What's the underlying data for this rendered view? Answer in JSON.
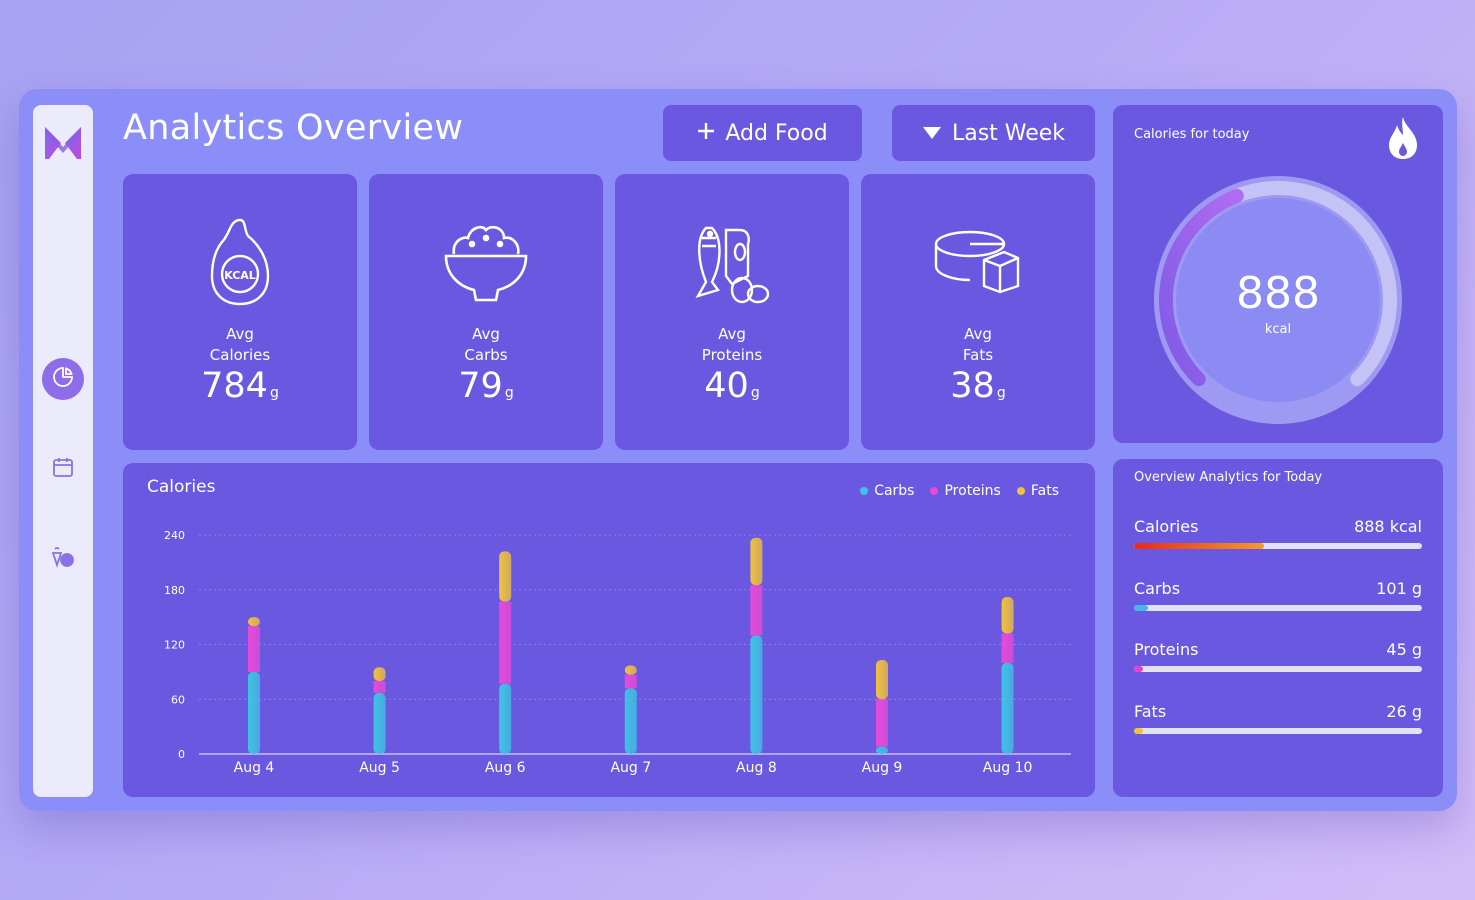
{
  "title": "Analytics Overview",
  "buttons": {
    "add_food": "Add Food",
    "period": "Last Week"
  },
  "sidebar": {
    "items": [
      {
        "icon": "pie-chart-icon"
      },
      {
        "icon": "calendar-icon"
      },
      {
        "icon": "food-icon"
      }
    ]
  },
  "stats": [
    {
      "label_1": "Avg",
      "label_2": "Calories",
      "value": "784",
      "unit": "g",
      "icon": "kcal-icon",
      "icon_text": "KCAL"
    },
    {
      "label_1": "Avg",
      "label_2": "Carbs",
      "value": "79",
      "unit": "g",
      "icon": "rice-bowl-icon"
    },
    {
      "label_1": "Avg",
      "label_2": "Proteins",
      "value": "40",
      "unit": "g",
      "icon": "protein-food-icon"
    },
    {
      "label_1": "Avg",
      "label_2": "Fats",
      "value": "38",
      "unit": "g",
      "icon": "cheese-icon"
    }
  ],
  "today": {
    "title": "Calories for today",
    "value": "888",
    "unit": "kcal",
    "progress": 0.42
  },
  "overview": {
    "title": "Overview Analytics for Today",
    "rows": [
      {
        "name": "Calories",
        "value": "888 kcal",
        "progress": 0.45,
        "color": "#f0471f"
      },
      {
        "name": "Carbs",
        "value": "101 g",
        "progress": 0.05,
        "color": "#3fb8e8"
      },
      {
        "name": "Proteins",
        "value": "45 g",
        "progress": 0.02,
        "color": "#e83fd2"
      },
      {
        "name": "Fats",
        "value": "26 g",
        "progress": 0.01,
        "color": "#f0c33a"
      }
    ]
  },
  "chart_data": {
    "type": "bar",
    "title": "Calories",
    "stacked": true,
    "categories": [
      "Aug 4",
      "Aug 5",
      "Aug 6",
      "Aug 7",
      "Aug 8",
      "Aug 9",
      "Aug 10"
    ],
    "series": [
      {
        "name": "Carbs",
        "color": "#3fc3e3",
        "values": [
          90,
          67,
          77,
          72,
          130,
          8,
          100
        ]
      },
      {
        "name": "Proteins",
        "color": "#e84ad8",
        "values": [
          50,
          13,
          90,
          15,
          55,
          52,
          32
        ]
      },
      {
        "name": "Fats",
        "color": "#f0c23c",
        "values": [
          10,
          15,
          55,
          10,
          52,
          43,
          40
        ]
      }
    ],
    "ylim": [
      0,
      240
    ],
    "yticks": [
      0,
      60,
      120,
      180,
      240
    ],
    "grid": true,
    "legend": "top-right"
  }
}
